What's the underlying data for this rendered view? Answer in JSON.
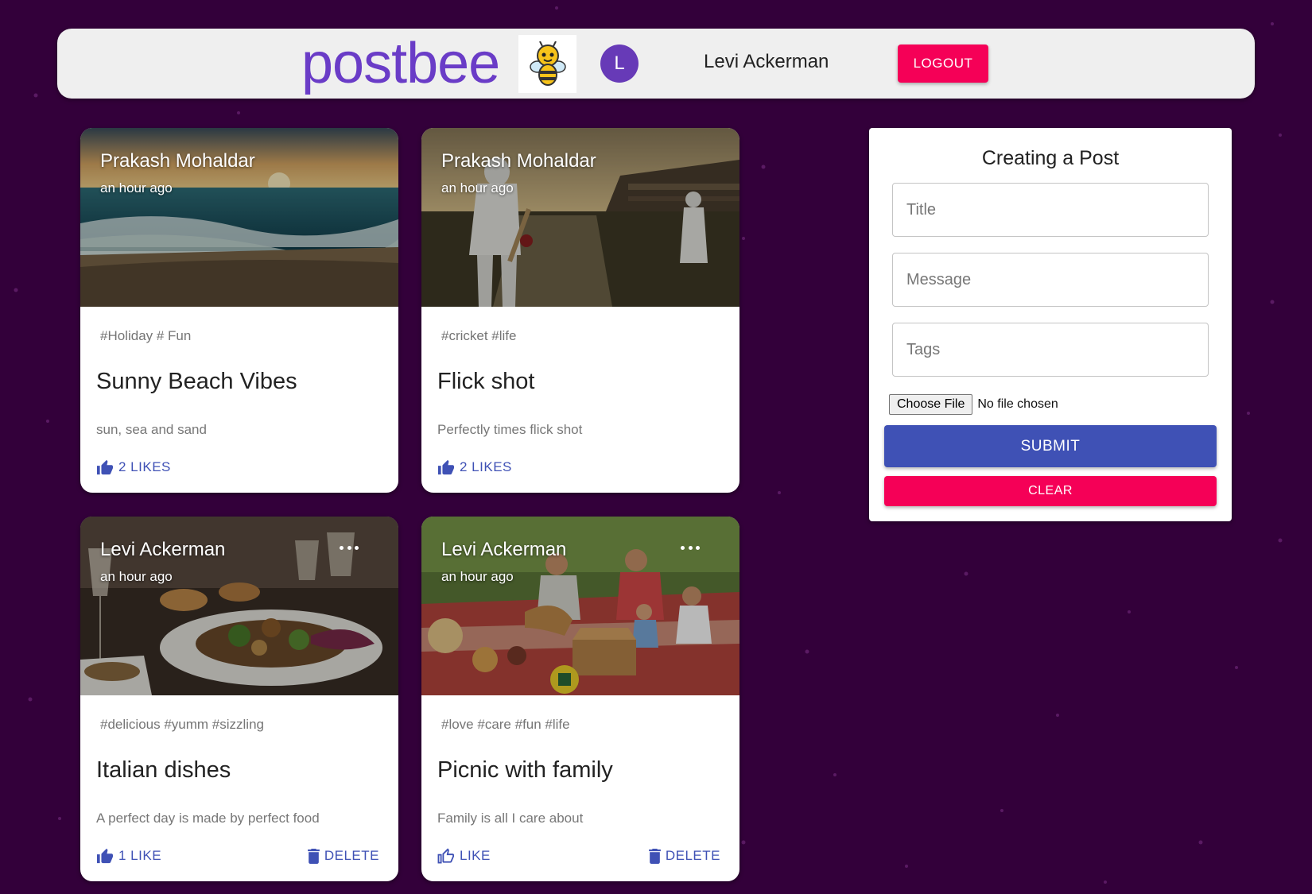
{
  "header": {
    "brand": "postbee",
    "avatar_initial": "L",
    "username": "Levi Ackerman",
    "logout_label": "LOGOUT"
  },
  "posts": [
    {
      "author": "Prakash Mohaldar",
      "time": "an hour ago",
      "tags": "#Holiday # Fun",
      "title": "Sunny Beach Vibes",
      "message": "sun, sea and sand",
      "like_label": "2 LIKES",
      "like_state": "filled",
      "owned": false
    },
    {
      "author": "Prakash Mohaldar",
      "time": "an hour ago",
      "tags": "#cricket #life",
      "title": "Flick shot",
      "message": "Perfectly times flick shot",
      "like_label": "2 LIKES",
      "like_state": "filled",
      "owned": false
    },
    {
      "author": "Levi Ackerman",
      "time": "an hour ago",
      "tags": "#delicious #yumm #sizzling",
      "title": "Italian dishes",
      "message": "A perfect day is made by perfect food",
      "like_label": "1 LIKE",
      "like_state": "filled",
      "owned": true,
      "delete_label": "DELETE"
    },
    {
      "author": "Levi Ackerman",
      "time": "an hour ago",
      "tags": "#love #care #fun #life",
      "title": "Picnic with family",
      "message": "Family is all I care about",
      "like_label": "LIKE",
      "like_state": "outline",
      "owned": true,
      "delete_label": "DELETE"
    }
  ],
  "form": {
    "title": "Creating a Post",
    "title_placeholder": "Title",
    "message_placeholder": "Message",
    "tags_placeholder": "Tags",
    "file_button": "Choose File",
    "file_status": "No file chosen",
    "submit_label": "SUBMIT",
    "clear_label": "CLEAR"
  },
  "colors": {
    "background": "#33003a",
    "brand": "#6a3cc7",
    "primary": "#3f51b5",
    "secondary": "#f50057",
    "avatar": "#673ab7"
  }
}
